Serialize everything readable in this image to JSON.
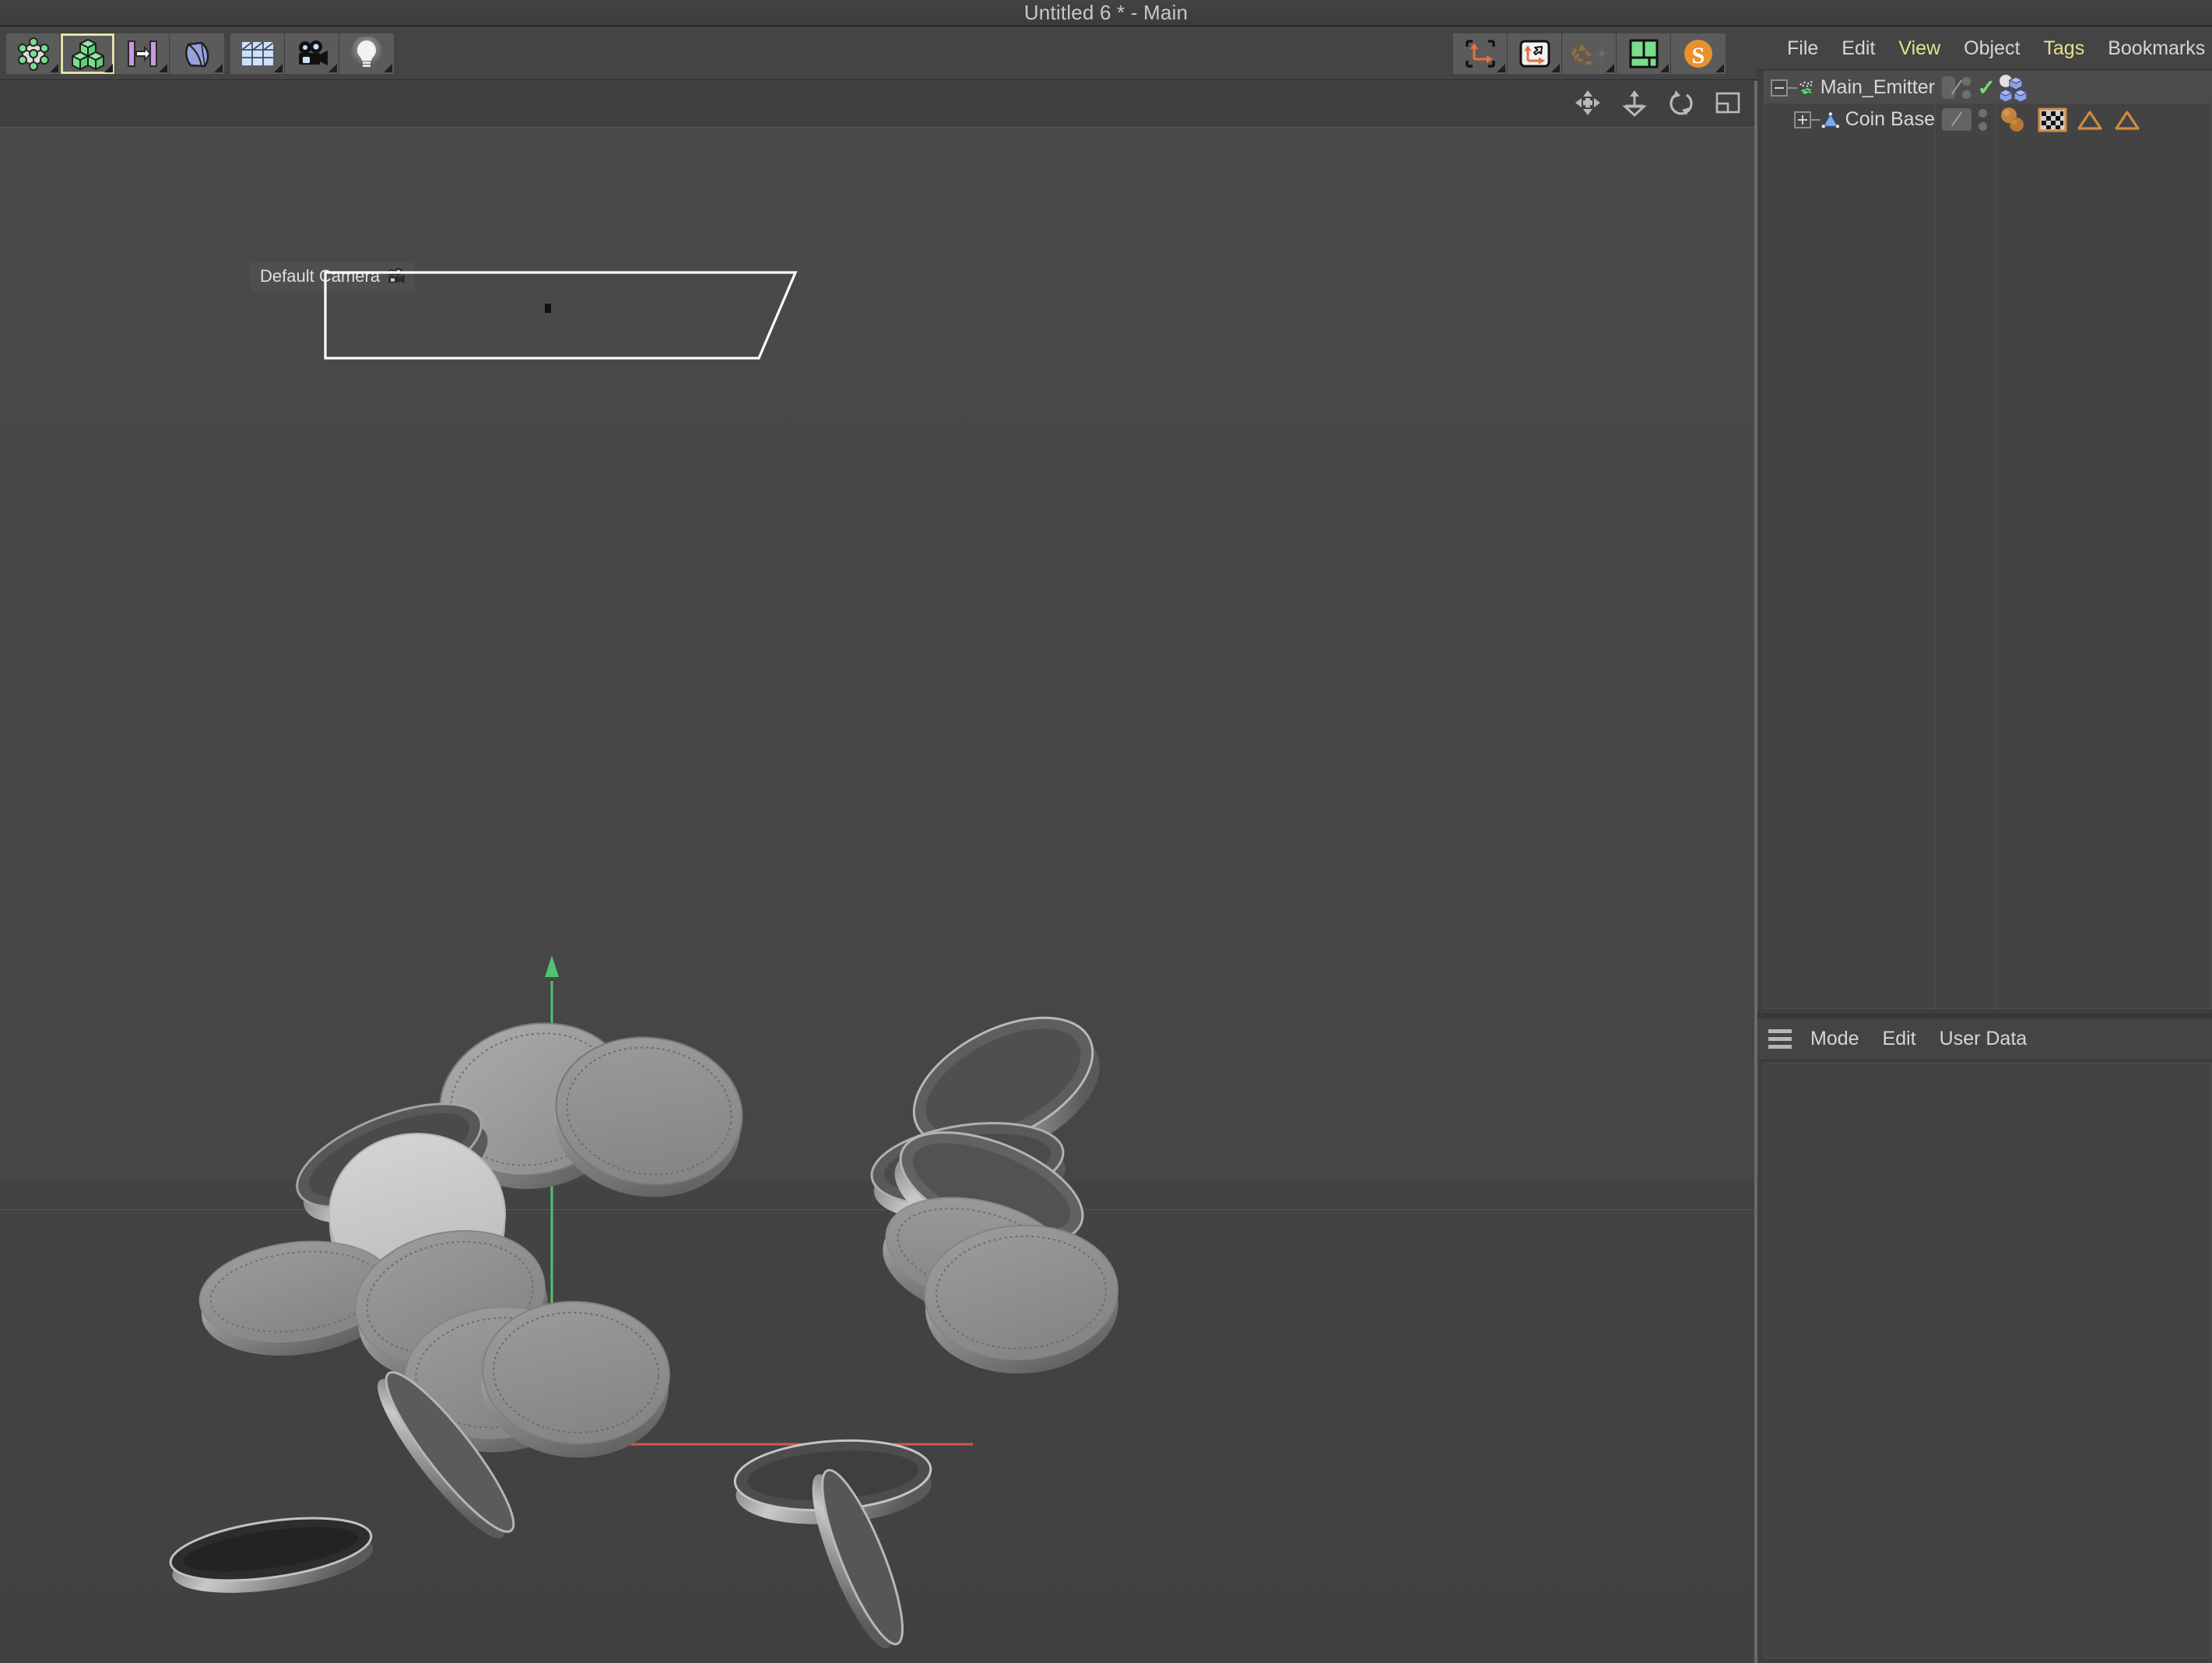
{
  "window": {
    "title": "Untitled 6 * - Main"
  },
  "toolbar": {
    "left_group": [
      {
        "name": "points-mode",
        "label": "Points"
      },
      {
        "name": "object-mode",
        "label": "Object",
        "selected": true
      },
      {
        "name": "model-axis-mode",
        "label": "Model / Axis"
      },
      {
        "name": "deformer-mode",
        "label": "Deformer"
      }
    ],
    "mid_group": [
      {
        "name": "floor-grid",
        "label": "Floor"
      },
      {
        "name": "camera",
        "label": "Camera"
      },
      {
        "name": "light",
        "label": "Light"
      }
    ],
    "right_group": [
      {
        "name": "world-axis",
        "label": "World Coordinate System"
      },
      {
        "name": "object-axis",
        "label": "Object Axis"
      },
      {
        "name": "render-settings",
        "label": "Render Settings"
      },
      {
        "name": "layout",
        "label": "Layout"
      },
      {
        "name": "substance",
        "label": "Substance"
      }
    ]
  },
  "viewport": {
    "camera_label": "Default Camera",
    "nav_buttons": [
      {
        "name": "pan-icon",
        "label": "Move"
      },
      {
        "name": "dolly-icon",
        "label": "Scale"
      },
      {
        "name": "rotate-icon",
        "label": "Rotate"
      },
      {
        "name": "viewport-layout-icon",
        "label": "Viewport Layout"
      }
    ],
    "axis_colors": {
      "x": "#d05a52",
      "y": "#4fc36f",
      "z": "#4a7fd6"
    },
    "background_color": "#474747",
    "emitter_wire_color": "#ffffff",
    "coin_count": 17
  },
  "object_manager": {
    "menu": [
      {
        "label": "File",
        "highlight": false
      },
      {
        "label": "Edit",
        "highlight": false
      },
      {
        "label": "View",
        "highlight": true
      },
      {
        "label": "Object",
        "highlight": false
      },
      {
        "label": "Tags",
        "highlight": true
      },
      {
        "label": "Bookmarks",
        "highlight": false
      }
    ],
    "objects": [
      {
        "name": "Main_Emitter",
        "icon": "emitter-icon",
        "expand": "minus",
        "depth": 0,
        "selected": true,
        "enable_check": true,
        "tags": [
          "cloner-matrix-tag"
        ]
      },
      {
        "name": "Coin Base",
        "icon": "polygon-object-icon",
        "expand": "plus",
        "depth": 1,
        "selected": false,
        "enable_check": false,
        "tags": [
          "material-tag",
          "texture-tag",
          "phong-tag",
          "phong-tag-2"
        ]
      }
    ]
  },
  "attribute_manager": {
    "menu": [
      {
        "label": "Mode"
      },
      {
        "label": "Edit"
      },
      {
        "label": "User Data"
      }
    ]
  }
}
